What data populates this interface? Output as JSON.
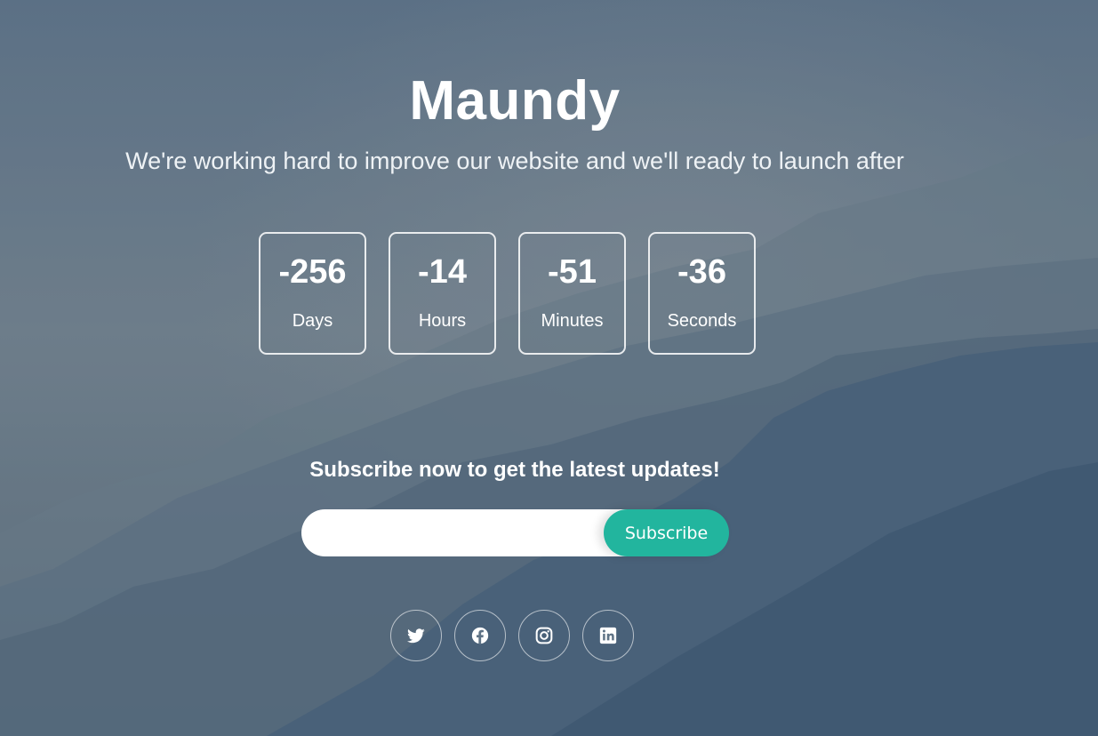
{
  "site": {
    "title": "Maundy",
    "tagline": "We're working hard to improve our website and we'll ready to launch after"
  },
  "countdown": [
    {
      "value": "-256",
      "unit": "Days"
    },
    {
      "value": "-14",
      "unit": "Hours"
    },
    {
      "value": "-51",
      "unit": "Minutes"
    },
    {
      "value": "-36",
      "unit": "Seconds"
    }
  ],
  "subscribe": {
    "heading": "Subscribe now to get the latest updates!",
    "email_value": "",
    "email_placeholder": "",
    "button_label": "Subscribe"
  },
  "social": [
    {
      "icon": "twitter-icon"
    },
    {
      "icon": "facebook-icon"
    },
    {
      "icon": "instagram-icon"
    },
    {
      "icon": "linkedin-icon"
    }
  ],
  "colors": {
    "accent": "#22b59e",
    "background": "#617587",
    "text": "#ffffff"
  }
}
